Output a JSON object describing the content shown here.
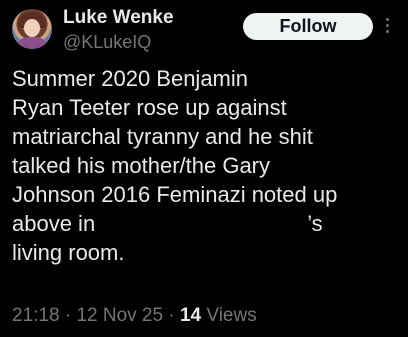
{
  "author": {
    "name": "Luke Wenke",
    "handle": "@KLukeIQ"
  },
  "follow_label": "Follow",
  "more_icon": "more-vertical-icon",
  "body_lines": [
    "Summer 2020 Benjamin",
    "Ryan Teeter rose up against",
    "matriarchal tyranny and he shit",
    "talked his mother/the Gary",
    "Johnson 2016 Feminazi noted up",
    "above in",
    "’s",
    "living room."
  ],
  "meta": {
    "time": "21:18",
    "separator": "·",
    "date": "12 Nov 25",
    "views_count": "14",
    "views_label": "Views"
  },
  "colors": {
    "background": "#000000",
    "text": "#e7e9ea",
    "secondary": "#71767b",
    "follow_bg": "#eff3f4"
  }
}
